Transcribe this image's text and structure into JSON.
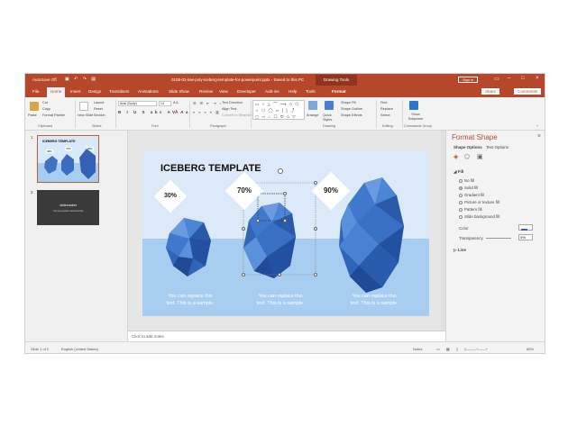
{
  "window": {
    "autosave_label": "AutoSave  Off",
    "document_title": "0108-01-low-poly-iceberg-template-for-powerpoint.pptx  -  Saved to this PC",
    "contextual_tab": "Drawing Tools",
    "signin_label": "Sign in"
  },
  "tabs": [
    "File",
    "Home",
    "Insert",
    "Design",
    "Transitions",
    "Animations",
    "Slide Show",
    "Review",
    "View",
    "Developer",
    "Add-ins",
    "Help",
    "Tools",
    "Format"
  ],
  "active_tab": "Home",
  "share_label": "Share",
  "comments_label": "Comments",
  "ribbon": {
    "paste": "Paste",
    "cut": "Cut",
    "copy": "Copy",
    "format_painter": "Format Painter",
    "new_slide": "New Slide",
    "layout": "Layout",
    "reset": "Reset",
    "section": "Section",
    "font_name": "Arial (Body)",
    "font_size": "14",
    "text_direction": "Text Direction",
    "align_text": "Align Text",
    "convert_smartart": "Convert to SmartArt",
    "arrange": "Arrange",
    "quick_styles": "Quick Styles",
    "shape_fill": "Shape Fill",
    "shape_outline": "Shape Outline",
    "shape_effects": "Shape Effects",
    "find": "Find",
    "replace": "Replace",
    "select": "Select",
    "show_solipower": "Show Solipower",
    "groups": [
      "Clipboard",
      "Slides",
      "Font",
      "Paragraph",
      "Drawing",
      "Editing",
      "Commands Group"
    ]
  },
  "thumbnails": [
    {
      "number": "1",
      "title": "ICEBERG TEMPLATE",
      "percents": [
        "30%",
        "70%",
        "90%"
      ]
    },
    {
      "number": "2",
      "title": "slidemarket",
      "subtitle": "Your presentation delivered fast"
    }
  ],
  "slide": {
    "title": "ICEBERG TEMPLATE",
    "percents": [
      "30%",
      "70%",
      "90%"
    ],
    "captions": [
      [
        "You can replace this",
        "text. This is a sample."
      ],
      [
        "You can replace this",
        "text. This is a sample."
      ],
      [
        "You can replace this",
        "text. This is a sample."
      ]
    ]
  },
  "notes_placeholder": "Click to add notes",
  "format_pane": {
    "title": "Format Shape",
    "tabs": [
      "Shape Options",
      "Text Options"
    ],
    "fill_section": "Fill",
    "fill_options": [
      "No fill",
      "Solid fill",
      "Gradient fill",
      "Picture or texture fill",
      "Pattern fill",
      "Slide background fill"
    ],
    "selected_fill": "Solid fill",
    "color_label": "Color",
    "transparency_label": "Transparency",
    "transparency_value": "0%",
    "line_section": "Line"
  },
  "status": {
    "slide_of": "Slide 1 of 2",
    "language": "English (United States)",
    "notes": "Notes",
    "zoom": "65%"
  },
  "colors": {
    "accent": "#b7472a",
    "slide_bg": "#dbe9f9",
    "water": "#a7cdf1",
    "iceberg": "#3e73c4"
  }
}
